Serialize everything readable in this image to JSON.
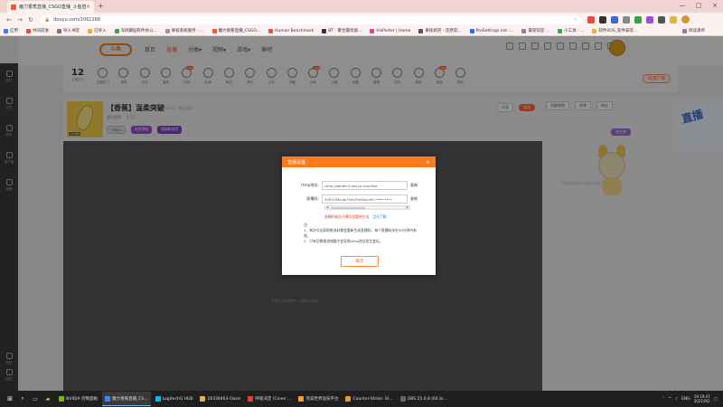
{
  "browser": {
    "tab_title": "魔力香蕉直播_CSGO直播_斗鱼直...",
    "tab_close": "×",
    "new_tab": "+",
    "window_controls": [
      "—",
      "□",
      "×"
    ],
    "url": "douyu.com/2061168",
    "bookmarks": [
      {
        "label": "应用",
        "color": "#4a7be0"
      },
      {
        "label": "共同前进",
        "color": "#e04a4a"
      },
      {
        "label": "导入书签",
        "color": "#777777"
      },
      {
        "label": "已导入",
        "color": "#e0b34a"
      },
      {
        "label": "深圳康园软件办公...",
        "color": "#3aa35a"
      },
      {
        "label": "果核系统服务 - ...",
        "color": "#999999"
      },
      {
        "label": "魔力香蕉直播_CSGO...",
        "color": "#f25a29"
      },
      {
        "label": "Human Benchmark",
        "color": "#d9534f"
      },
      {
        "label": "BT - 聚合最优质...",
        "color": "#333333"
      },
      {
        "label": "IrisPorter | Home",
        "color": "#d94a8c"
      },
      {
        "label": "果核剥壳 - 还原软...",
        "color": "#555555"
      },
      {
        "label": "ProSettings.net -...",
        "color": "#3b6ad6"
      },
      {
        "label": "最受欢迎 ...",
        "color": "#888888"
      },
      {
        "label": "小工具 - ...",
        "color": "#3aa35a"
      },
      {
        "label": "软件SOS_软件安装...",
        "color": "#e0b34a"
      }
    ],
    "bookmarks_other": "阅读清单"
  },
  "site": {
    "logo": "斗鱼",
    "nav": [
      "首页",
      "直播",
      "分类▾",
      "视频▾",
      "游戏▾",
      "鱼吧"
    ],
    "nav_active_index": 1,
    "date_num": "12",
    "date_label": "主播节日",
    "categories": [
      {
        "label": "主播热门",
        "badge": ""
      },
      {
        "label": "推荐",
        "badge": ""
      },
      {
        "label": "任务",
        "badge": ""
      },
      {
        "label": "道具",
        "badge": ""
      },
      {
        "label": "红包",
        "badge": "new"
      },
      {
        "label": "礼物",
        "badge": ""
      },
      {
        "label": "粉丝",
        "badge": ""
      },
      {
        "label": "排行",
        "badge": ""
      },
      {
        "label": "上传",
        "badge": ""
      },
      {
        "label": "开播",
        "badge": ""
      },
      {
        "label": "伙伴",
        "badge": "new"
      },
      {
        "label": "主播",
        "badge": ""
      },
      {
        "label": "设置",
        "badge": ""
      },
      {
        "label": "管理",
        "badge": ""
      },
      {
        "label": "游戏",
        "badge": ""
      },
      {
        "label": "数据",
        "badge": ""
      },
      {
        "label": "更多",
        "badge": "new"
      },
      {
        "label": "助手",
        "badge": ""
      }
    ],
    "pc_button": "PC客户端"
  },
  "sidebar": {
    "items": [
      "关注",
      "历史",
      "游戏",
      "客户端",
      "推荐"
    ],
    "bottom_items": [
      "收起",
      "回顶"
    ]
  },
  "room": {
    "title": "【香蕉】温柔突破",
    "category": "CSGO · 射击游戏 · ...",
    "meta": [
      "魔力香蕉",
      "5.5万"
    ],
    "cover_label": "Lv.60",
    "tags": [
      "CSGO",
      "电竞游戏",
      "超级粉丝团"
    ],
    "share": "分享",
    "follow": "关注"
  },
  "video": {
    "message": "主播正在直播中，请稍后再试"
  },
  "right": {
    "tabs": [
      "贡献周榜",
      "贵宾",
      "粉丝"
    ],
    "gift_button": "送礼物",
    "mascot_caption": "还没有粉丝给主播送礼物哦",
    "banner_text": "直播"
  },
  "dialog": {
    "title": "直播设置",
    "close": "×",
    "rtmp_label": "rtmp地址:",
    "rtmp_value": "rtmp://sendtc3.douyu.com/live",
    "code_label": "直播码:",
    "code_value": "2061168rulo7Ixhij?wsSecret=",
    "copy_label": "复制",
    "warning": "直播码每次开播均会重新生成",
    "warning_link": "点击了解",
    "notes": [
      "注:",
      "1、每次点击获取推流码都会重新生成直播码，每个直播码仅在30分钟内有效。",
      "2、只有切换推流线路才会导致rtmp地址发生变化。"
    ],
    "ok_button": "确定"
  },
  "taskbar": {
    "apps": [
      {
        "label": "NVIDIA 控制面板",
        "color": "#76b900",
        "active": false
      },
      {
        "label": "魔力香蕉直播_CS...",
        "color": "#4285f4",
        "active": true
      },
      {
        "label": "LogitechG HUB",
        "color": "#00b8fc",
        "active": false
      },
      {
        "label": "26338463-Oasis",
        "color": "#e0b34a",
        "active": false
      },
      {
        "label": "呼吸决定 (Cover ...",
        "color": "#e53c2e",
        "active": false
      },
      {
        "label": "完美世界竞技平台",
        "color": "#f0a030",
        "active": false
      },
      {
        "label": "Counter-Strike: Gl...",
        "color": "#e39b2c",
        "active": false
      },
      {
        "label": "OBS 25.0.8 (64 bi...",
        "color": "#666666",
        "active": false
      }
    ],
    "lang": "ENG",
    "time": "19:19:47",
    "date": "2021/9/2"
  }
}
